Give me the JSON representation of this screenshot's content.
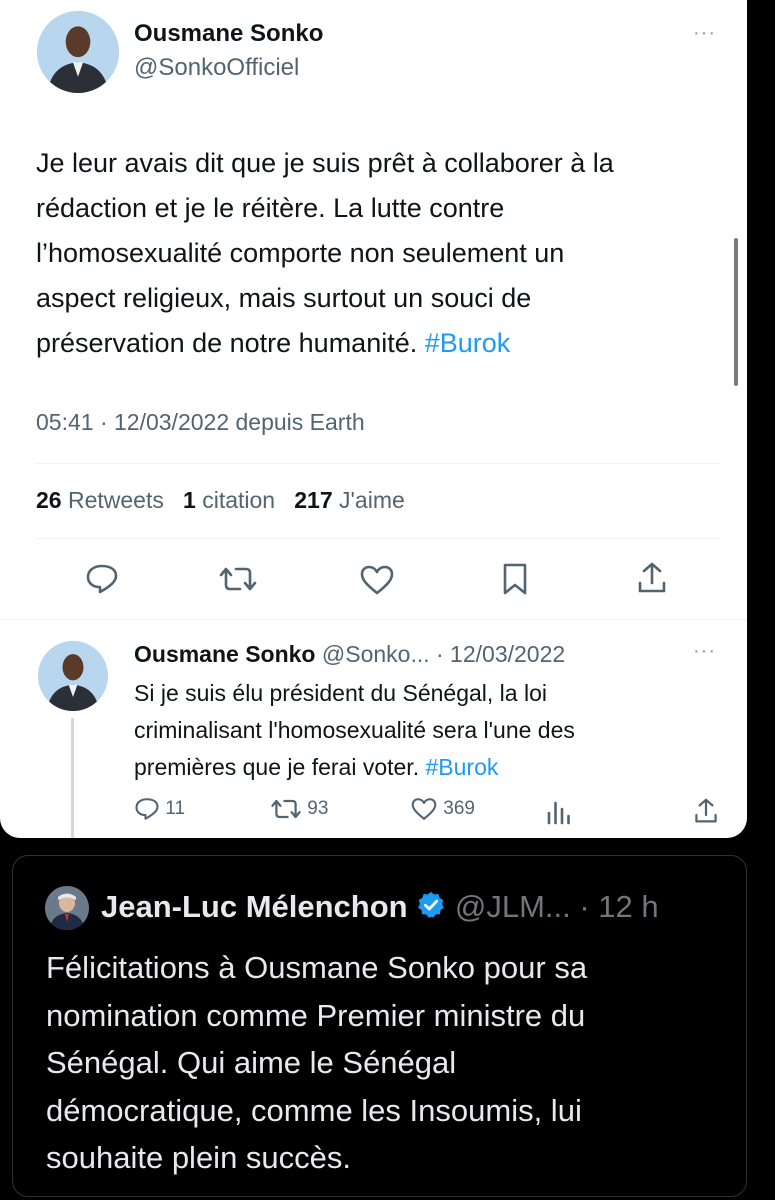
{
  "main_tweet": {
    "author_name": "Ousmane Sonko",
    "handle": "@SonkoOfficiel",
    "more_label": "···",
    "text_lines": [
      "Je leur avais dit que je suis prêt à collaborer à la",
      "rédaction et je le réitère. La lutte contre",
      "l’homosexualité comporte non seulement un",
      "aspect religieux, mais surtout un souci de",
      "préservation de notre humanité."
    ],
    "hashtag": "#Burok",
    "meta": "05:41 · 12/03/2022 depuis Earth",
    "stats": {
      "retweets_count": "26",
      "retweets_label": "Retweets",
      "quotes_count": "1",
      "quotes_label": "citation",
      "likes_count": "217",
      "likes_label": "J'aime"
    },
    "actions": [
      "reply-icon",
      "retweet-icon",
      "like-icon",
      "bookmark-icon",
      "share-icon"
    ]
  },
  "reply_tweet": {
    "author_name": "Ousmane Sonko",
    "handle_date": "@Sonko... · 12/03/2022",
    "more_label": "···",
    "text_lines": [
      "Si je suis élu président du Sénégal, la loi",
      "criminalisant l'homosexualité sera l'une des",
      "premières que je ferai voter."
    ],
    "hashtag": "#Burok",
    "reply_count": "11",
    "retweet_count": "93",
    "like_count": "369"
  },
  "quote_tweet": {
    "author_name": "Jean-Luc Mélenchon",
    "handle": "@JLM...",
    "time": "· 12 h",
    "text_lines": [
      "Félicitations à Ousmane Sonko pour sa",
      "nomination comme Premier ministre du",
      "Sénégal. Qui aime le Sénégal",
      "démocratique, comme les Insoumis, lui",
      "souhaite plein succès."
    ]
  },
  "colors": {
    "link": "#1d9bf0",
    "muted": "#536471",
    "verified": "#1d9bf0",
    "dark_text": "#e7e9ea"
  }
}
